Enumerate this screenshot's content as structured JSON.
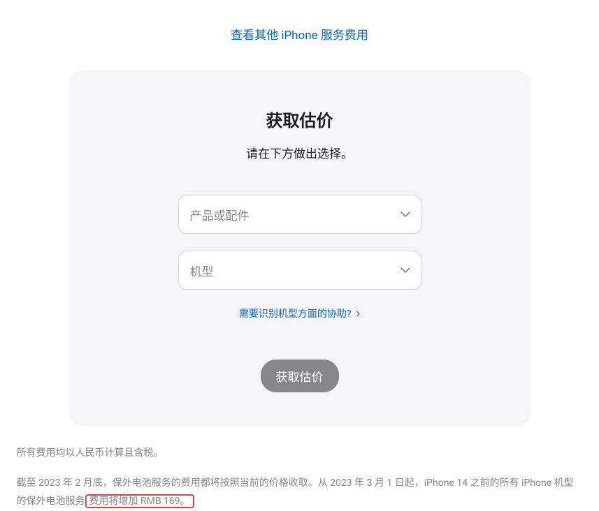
{
  "top_link": "查看其他 iPhone 服务费用",
  "card": {
    "title": "获取估价",
    "subtitle": "请在下方做出选择。",
    "select_product_placeholder": "产品或配件",
    "select_model_placeholder": "机型",
    "help_link": "需要识别机型方面的协助?",
    "submit_label": "获取估价"
  },
  "footnotes": {
    "line1": "所有费用均以人民币计算且含税。",
    "line2_part1": "截至 2023 年 2 月底，保外电池服务的费用都将按照当前的价格收取。从 2023 年 3 月 1 日起，iPhone 14 之前的所有 iPhone 机型的保外电池服务",
    "line2_highlight": "费用将增加 RMB 169。"
  }
}
